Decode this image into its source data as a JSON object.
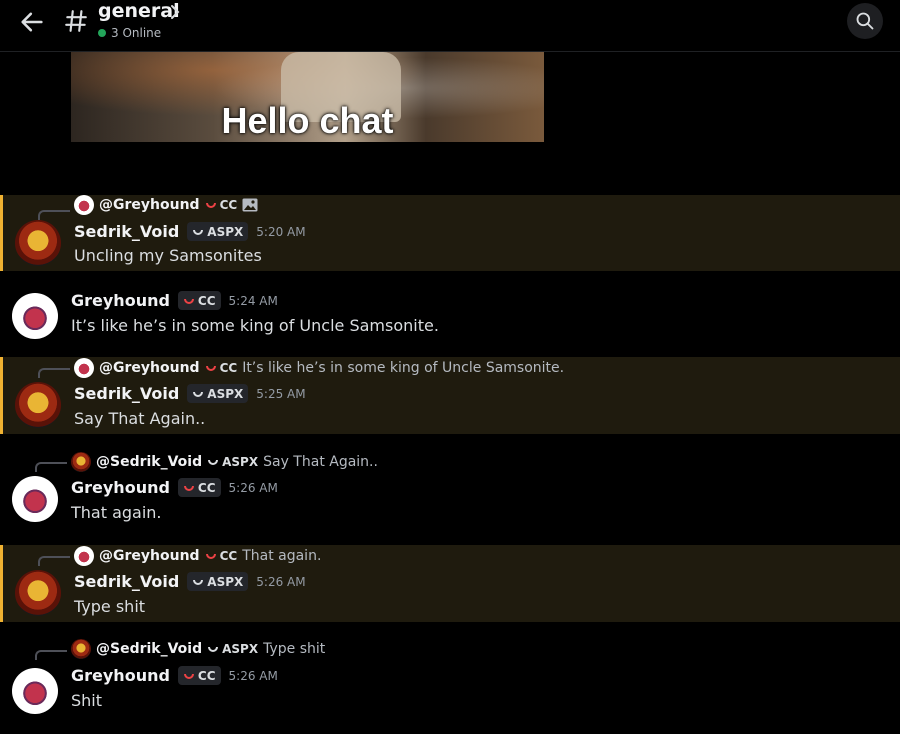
{
  "header": {
    "channel_name": "general",
    "online_status": "3 Online"
  },
  "embed": {
    "caption": "Hello chat"
  },
  "messages": [
    {
      "reply_user": "@Greyhound",
      "reply_tag": "CC",
      "reply_text": "",
      "author": "Sedrik_Void",
      "tag": "ASPX",
      "time": "5:20 AM",
      "text": "Uncling my Samsonites"
    },
    {
      "author": "Greyhound",
      "tag": "CC",
      "time": "5:24 AM",
      "text": "It’s like he’s in some king of Uncle Samsonite."
    },
    {
      "reply_user": "@Greyhound",
      "reply_tag": "CC",
      "reply_text": "It’s like he’s in some king of Uncle Samsonite.",
      "author": "Sedrik_Void",
      "tag": "ASPX",
      "time": "5:25 AM",
      "text": "Say That Again.."
    },
    {
      "reply_user": "@Sedrik_Void",
      "reply_tag": "ASPX",
      "reply_text": "Say That Again..",
      "author": "Greyhound",
      "tag": "CC",
      "time": "5:26 AM",
      "text": "That again."
    },
    {
      "reply_user": "@Greyhound",
      "reply_tag": "CC",
      "reply_text": "That again.",
      "author": "Sedrik_Void",
      "tag": "ASPX",
      "time": "5:26 AM",
      "text": "Type shit"
    },
    {
      "reply_user": "@Sedrik_Void",
      "reply_tag": "ASPX",
      "reply_text": "Type shit",
      "author": "Greyhound",
      "tag": "CC",
      "time": "5:26 AM",
      "text": "Shit"
    }
  ]
}
